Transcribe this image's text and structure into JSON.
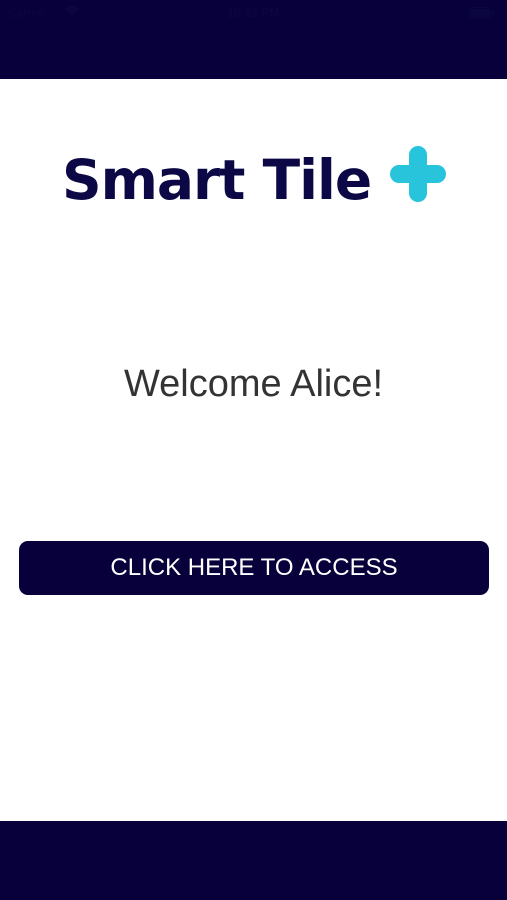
{
  "status_bar": {
    "carrier": "Carrier",
    "time": "10:52 PM",
    "wifi_icon": "wifi-icon",
    "battery_icon": "battery-icon"
  },
  "logo": {
    "text": "Smart Tile",
    "plus_icon": "plus-icon",
    "text_color": "#0b0845",
    "plus_color": "#27c4dc"
  },
  "welcome": {
    "message": "Welcome Alice!"
  },
  "access_button": {
    "label": "CLICK HERE TO ACCESS"
  },
  "colors": {
    "navy": "#08003a",
    "background": "#ffffff",
    "text": "#333333"
  }
}
